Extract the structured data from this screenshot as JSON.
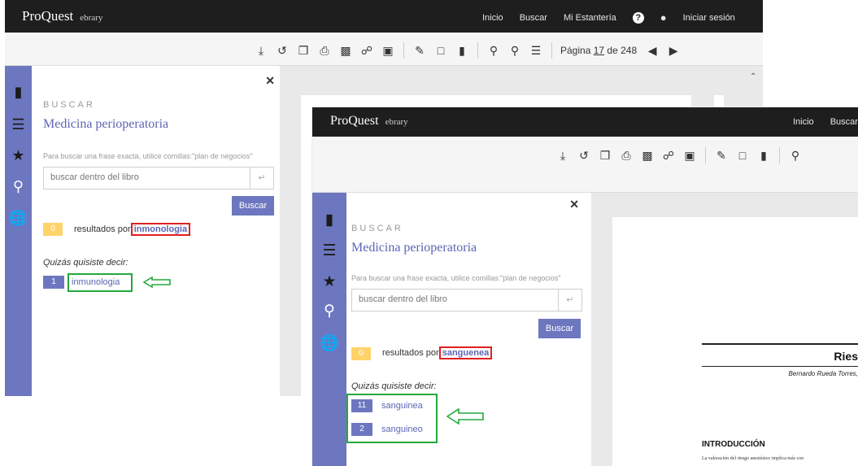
{
  "app": {
    "logo": "ProQuest",
    "logo_sub": "ebrary"
  },
  "nav": {
    "inicio": "Inicio",
    "buscar": "Buscar",
    "estanteria": "Mi Estantería",
    "help": "?",
    "login": "Iniciar sesión"
  },
  "pager": {
    "label": "Página",
    "current": "17",
    "of": "de 248"
  },
  "search": {
    "heading": "BUSCAR",
    "book_title": "Medicina perioperatoria",
    "hint": "Para buscar una frase exacta, utilice comillas:\"plan de negocios\"",
    "placeholder": "buscar dentro del libro",
    "button": "Buscar",
    "results_prefix": "resultados por",
    "did_you_mean": "Quizás quisiste decir:"
  },
  "left": {
    "count": "0",
    "term": "inmonologia",
    "suggestions": [
      {
        "count": "1",
        "text": "inmunologia"
      }
    ]
  },
  "right": {
    "count": "0",
    "term": "sanguenea",
    "suggestions": [
      {
        "count": "11",
        "text": "sanguinea"
      },
      {
        "count": "2",
        "text": "sanguineo"
      }
    ],
    "nav_inicio": "Inicio",
    "nav_buscar": "Buscar"
  },
  "doc": {
    "title_fragment": "Ries",
    "author_fragment": "Bernardo Rueda Torres, ",
    "section": "INTRODUCCIÓN",
    "body_fragment": "La valoración del riesgo anestésico implica más con"
  },
  "colors": {
    "rail": "#6d77c0",
    "accent": "#5b65b4",
    "topbar": "#1e1e1e",
    "highlight_red": "#e02020",
    "highlight_green": "#23a93b",
    "zero_badge": "#ffd36a"
  }
}
